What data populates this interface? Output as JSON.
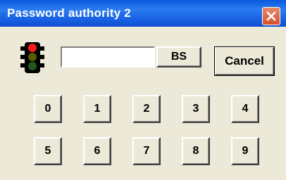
{
  "window": {
    "title": "Password authority 2"
  },
  "password": {
    "value": ""
  },
  "buttons": {
    "backspace": "BS",
    "cancel": "Cancel"
  },
  "keypad": {
    "row1": [
      "0",
      "1",
      "2",
      "3",
      "4"
    ],
    "row2": [
      "5",
      "6",
      "7",
      "8",
      "9"
    ]
  },
  "icons": {
    "status": "traffic-light-icon",
    "close": "close-icon"
  }
}
